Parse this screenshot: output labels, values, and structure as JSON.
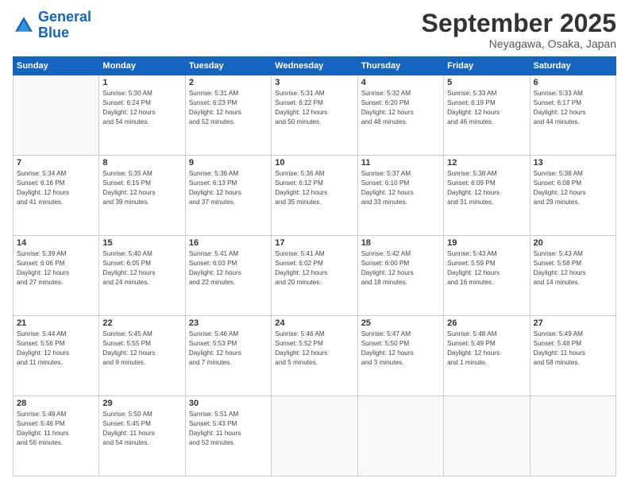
{
  "logo": {
    "line1": "General",
    "line2": "Blue"
  },
  "title": "September 2025",
  "location": "Neyagawa, Osaka, Japan",
  "days_header": [
    "Sunday",
    "Monday",
    "Tuesday",
    "Wednesday",
    "Thursday",
    "Friday",
    "Saturday"
  ],
  "weeks": [
    [
      {
        "day": "",
        "info": ""
      },
      {
        "day": "1",
        "info": "Sunrise: 5:30 AM\nSunset: 6:24 PM\nDaylight: 12 hours\nand 54 minutes."
      },
      {
        "day": "2",
        "info": "Sunrise: 5:31 AM\nSunset: 6:23 PM\nDaylight: 12 hours\nand 52 minutes."
      },
      {
        "day": "3",
        "info": "Sunrise: 5:31 AM\nSunset: 6:22 PM\nDaylight: 12 hours\nand 50 minutes."
      },
      {
        "day": "4",
        "info": "Sunrise: 5:32 AM\nSunset: 6:20 PM\nDaylight: 12 hours\nand 48 minutes."
      },
      {
        "day": "5",
        "info": "Sunrise: 5:33 AM\nSunset: 6:19 PM\nDaylight: 12 hours\nand 46 minutes."
      },
      {
        "day": "6",
        "info": "Sunrise: 5:33 AM\nSunset: 6:17 PM\nDaylight: 12 hours\nand 44 minutes."
      }
    ],
    [
      {
        "day": "7",
        "info": "Sunrise: 5:34 AM\nSunset: 6:16 PM\nDaylight: 12 hours\nand 41 minutes."
      },
      {
        "day": "8",
        "info": "Sunrise: 5:35 AM\nSunset: 6:15 PM\nDaylight: 12 hours\nand 39 minutes."
      },
      {
        "day": "9",
        "info": "Sunrise: 5:36 AM\nSunset: 6:13 PM\nDaylight: 12 hours\nand 37 minutes."
      },
      {
        "day": "10",
        "info": "Sunrise: 5:36 AM\nSunset: 6:12 PM\nDaylight: 12 hours\nand 35 minutes."
      },
      {
        "day": "11",
        "info": "Sunrise: 5:37 AM\nSunset: 6:10 PM\nDaylight: 12 hours\nand 33 minutes."
      },
      {
        "day": "12",
        "info": "Sunrise: 5:38 AM\nSunset: 6:09 PM\nDaylight: 12 hours\nand 31 minutes."
      },
      {
        "day": "13",
        "info": "Sunrise: 5:38 AM\nSunset: 6:08 PM\nDaylight: 12 hours\nand 29 minutes."
      }
    ],
    [
      {
        "day": "14",
        "info": "Sunrise: 5:39 AM\nSunset: 6:06 PM\nDaylight: 12 hours\nand 27 minutes."
      },
      {
        "day": "15",
        "info": "Sunrise: 5:40 AM\nSunset: 6:05 PM\nDaylight: 12 hours\nand 24 minutes."
      },
      {
        "day": "16",
        "info": "Sunrise: 5:41 AM\nSunset: 6:03 PM\nDaylight: 12 hours\nand 22 minutes."
      },
      {
        "day": "17",
        "info": "Sunrise: 5:41 AM\nSunset: 6:02 PM\nDaylight: 12 hours\nand 20 minutes."
      },
      {
        "day": "18",
        "info": "Sunrise: 5:42 AM\nSunset: 6:00 PM\nDaylight: 12 hours\nand 18 minutes."
      },
      {
        "day": "19",
        "info": "Sunrise: 5:43 AM\nSunset: 5:59 PM\nDaylight: 12 hours\nand 16 minutes."
      },
      {
        "day": "20",
        "info": "Sunrise: 5:43 AM\nSunset: 5:58 PM\nDaylight: 12 hours\nand 14 minutes."
      }
    ],
    [
      {
        "day": "21",
        "info": "Sunrise: 5:44 AM\nSunset: 5:56 PM\nDaylight: 12 hours\nand 11 minutes."
      },
      {
        "day": "22",
        "info": "Sunrise: 5:45 AM\nSunset: 5:55 PM\nDaylight: 12 hours\nand 9 minutes."
      },
      {
        "day": "23",
        "info": "Sunrise: 5:46 AM\nSunset: 5:53 PM\nDaylight: 12 hours\nand 7 minutes."
      },
      {
        "day": "24",
        "info": "Sunrise: 5:46 AM\nSunset: 5:52 PM\nDaylight: 12 hours\nand 5 minutes."
      },
      {
        "day": "25",
        "info": "Sunrise: 5:47 AM\nSunset: 5:50 PM\nDaylight: 12 hours\nand 3 minutes."
      },
      {
        "day": "26",
        "info": "Sunrise: 5:48 AM\nSunset: 5:49 PM\nDaylight: 12 hours\nand 1 minute."
      },
      {
        "day": "27",
        "info": "Sunrise: 5:49 AM\nSunset: 5:48 PM\nDaylight: 11 hours\nand 58 minutes."
      }
    ],
    [
      {
        "day": "28",
        "info": "Sunrise: 5:49 AM\nSunset: 5:46 PM\nDaylight: 11 hours\nand 56 minutes."
      },
      {
        "day": "29",
        "info": "Sunrise: 5:50 AM\nSunset: 5:45 PM\nDaylight: 11 hours\nand 54 minutes."
      },
      {
        "day": "30",
        "info": "Sunrise: 5:51 AM\nSunset: 5:43 PM\nDaylight: 11 hours\nand 52 minutes."
      },
      {
        "day": "",
        "info": ""
      },
      {
        "day": "",
        "info": ""
      },
      {
        "day": "",
        "info": ""
      },
      {
        "day": "",
        "info": ""
      }
    ]
  ]
}
